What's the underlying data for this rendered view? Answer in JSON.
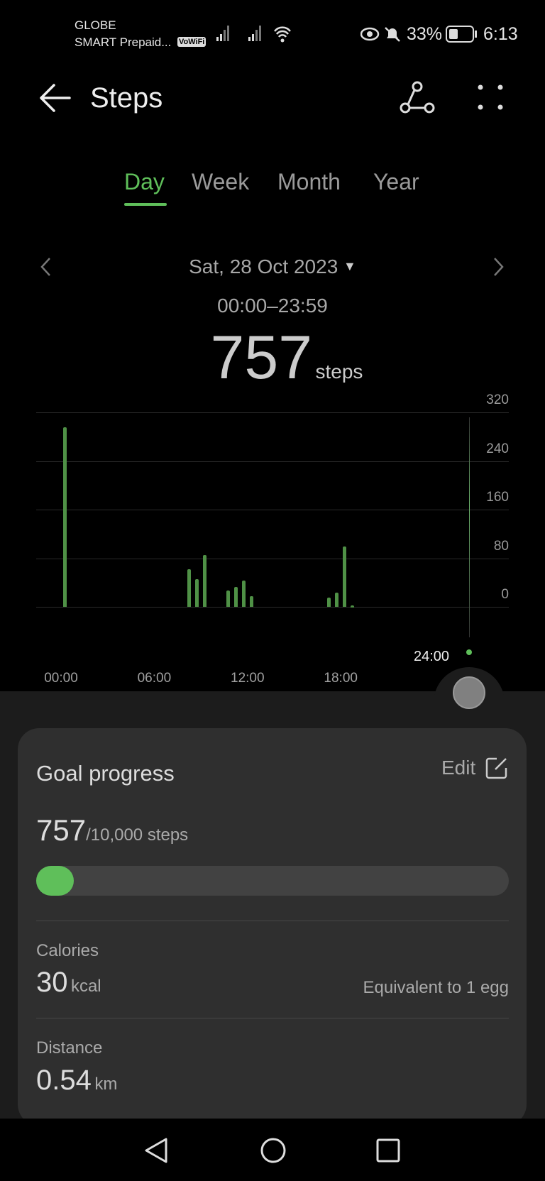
{
  "status_bar": {
    "carrier1": "GLOBE",
    "carrier2": "SMART Prepaid...",
    "vowifi": "VoWiFi",
    "battery": "33%",
    "time": "6:13"
  },
  "header": {
    "title": "Steps",
    "icons": [
      "back-arrow",
      "share-icon",
      "more-icon"
    ]
  },
  "tabs": [
    {
      "label": "Day",
      "active": true
    },
    {
      "label": "Week"
    },
    {
      "label": "Month"
    },
    {
      "label": "Year"
    }
  ],
  "date": {
    "label": "Sat, 28 Oct 2023",
    "range": "00:00–23:59"
  },
  "summary": {
    "value": "757",
    "unit": "steps"
  },
  "chart_data": {
    "type": "bar",
    "x": [
      "00:00",
      "08:00",
      "08:30",
      "09:00",
      "10:30",
      "11:00",
      "11:30",
      "12:00",
      "17:00",
      "17:30",
      "18:00",
      "18:30"
    ],
    "values": [
      296,
      62,
      45,
      85,
      27,
      33,
      43,
      17,
      15,
      23,
      99,
      2
    ],
    "ylim": [
      0,
      320
    ],
    "y_ticks": [
      "320",
      "240",
      "160",
      "80",
      "0"
    ],
    "x_ticks": [
      "00:00",
      "06:00",
      "12:00",
      "18:00"
    ],
    "cursor_label": "24:00",
    "grid": true,
    "color": "#4f9146"
  },
  "goal": {
    "title": "Goal progress",
    "edit": "Edit",
    "current": "757",
    "target": "/10,000 steps",
    "progress_percent": 7.57,
    "accent": "#5fbf5a"
  },
  "calories": {
    "label": "Calories",
    "value": "30",
    "unit": "kcal",
    "equivalent": "Equivalent to 1 egg"
  },
  "distance": {
    "label": "Distance",
    "value": "0.54",
    "unit": "km"
  }
}
